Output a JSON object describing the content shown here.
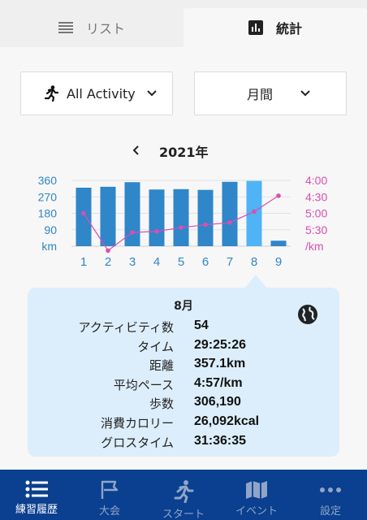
{
  "tabs": {
    "list_label": "リスト",
    "stats_label": "統計"
  },
  "filters": {
    "activity": "All Activity",
    "period": "月間"
  },
  "year": "2021年",
  "chart_data": {
    "type": "bar",
    "categories": [
      "1",
      "2",
      "3",
      "4",
      "5",
      "6",
      "7",
      "8",
      "9"
    ],
    "series": [
      {
        "values": [
          320,
          325,
          350,
          310,
          312,
          308,
          352,
          357.1,
          30
        ]
      },
      {
        "values": [
          "5:00",
          "6:08",
          "5:35",
          "5:33",
          "5:26",
          "5:21",
          "5:17",
          "4:57",
          "4:28"
        ]
      }
    ],
    "left_ticks": [
      "360",
      "270",
      "180",
      "90",
      "km"
    ],
    "right_ticks": [
      "4:00",
      "4:30",
      "5:00",
      "5:30",
      "/km"
    ],
    "ylim": [
      0,
      360
    ],
    "pace_range": [
      "4:00",
      "6:00"
    ],
    "highlight": "8",
    "colors": {
      "bar": "#2f86c8",
      "bar_highlight": "#4fb3f6",
      "line": "#d94fb0",
      "axis_left": "#2f86c8",
      "axis_right": "#d94fb0"
    }
  },
  "popup": {
    "month": "8月",
    "rows": [
      {
        "label": "アクティビティ数",
        "value": "54"
      },
      {
        "label": "タイム",
        "value": "29:25:26"
      },
      {
        "label": "距離",
        "value": "357.1km"
      },
      {
        "label": "平均ペース",
        "value": "4:57/km"
      },
      {
        "label": "歩数",
        "value": "306,190"
      },
      {
        "label": "消費カロリー",
        "value": "26,092kcal"
      },
      {
        "label": "グロスタイム",
        "value": "31:36:35"
      }
    ]
  },
  "bottom_nav": {
    "items": [
      {
        "label": "練習履歴",
        "icon": "list-icon"
      },
      {
        "label": "大会",
        "icon": "flag-icon"
      },
      {
        "label": "スタート",
        "icon": "runner-icon"
      },
      {
        "label": "イベント",
        "icon": "map-icon"
      },
      {
        "label": "設定",
        "icon": "more-icon"
      }
    ]
  }
}
